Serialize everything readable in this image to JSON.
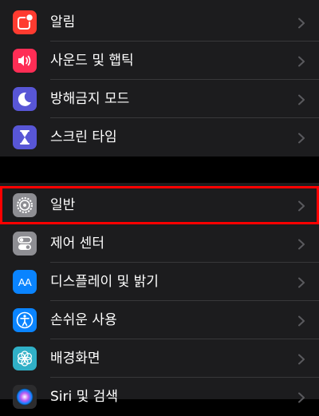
{
  "colors": {
    "background": "#000000",
    "group_background": "#1c1c1e",
    "separator": "#38383a",
    "chevron": "#5a5a5e",
    "highlight": "#ff0000"
  },
  "group_top": [
    {
      "label": "알림",
      "icon": "notifications-icon",
      "icon_color": "#ff3b30"
    },
    {
      "label": "사운드 및 햅틱",
      "icon": "speaker-icon",
      "icon_color": "#ff2d55"
    },
    {
      "label": "방해금지 모드",
      "icon": "moon-icon",
      "icon_color": "#5856d6"
    },
    {
      "label": "스크린 타임",
      "icon": "hourglass-icon",
      "icon_color": "#5856d6"
    }
  ],
  "group_main": [
    {
      "label": "일반",
      "icon": "gear-icon",
      "icon_color": "#8e8e93",
      "highlighted": true
    },
    {
      "label": "제어 센터",
      "icon": "toggles-icon",
      "icon_color": "#8e8e93"
    },
    {
      "label": "디스플레이 및 밝기",
      "icon": "text-size-icon",
      "icon_color": "#0a84ff",
      "icon_text": "AA"
    },
    {
      "label": "손쉬운 사용",
      "icon": "accessibility-icon",
      "icon_color": "#0a84ff"
    },
    {
      "label": "배경화면",
      "icon": "flower-icon",
      "icon_color": "#30b0c7"
    },
    {
      "label": "Siri 및 검색",
      "icon": "siri-icon",
      "icon_color": "#2c2c2e"
    }
  ]
}
